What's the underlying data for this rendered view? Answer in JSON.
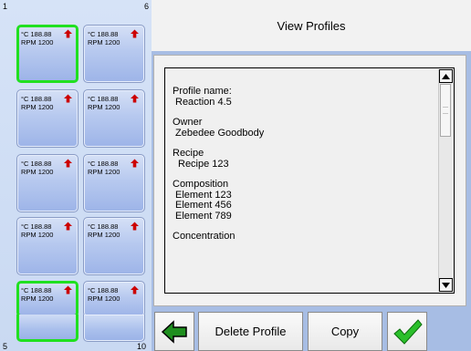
{
  "title": "View Profiles",
  "grid": {
    "corner_labels": {
      "top_left": "1",
      "top_right": "6",
      "bottom_left": "5",
      "bottom_right": "10"
    },
    "cells": [
      {
        "temp": "°C 188.88",
        "rpm": "RPM 1200",
        "selected": true,
        "has_data": true
      },
      {
        "temp": "°C 188.88",
        "rpm": "RPM 1200",
        "selected": false,
        "has_data": true
      },
      {
        "temp": "°C 188.88",
        "rpm": "RPM 1200",
        "selected": false,
        "has_data": true
      },
      {
        "temp": "°C 188.88",
        "rpm": "RPM 1200",
        "selected": false,
        "has_data": true
      },
      {
        "temp": "°C 188.88",
        "rpm": "RPM 1200",
        "selected": false,
        "has_data": true
      },
      {
        "temp": "°C 188.88",
        "rpm": "RPM 1200",
        "selected": false,
        "has_data": true
      },
      {
        "temp": "°C 188.88",
        "rpm": "RPM 1200",
        "selected": false,
        "has_data": true
      },
      {
        "temp": "°C 188.88",
        "rpm": "RPM 1200",
        "selected": false,
        "has_data": true
      },
      {
        "temp": "°C 188.88",
        "rpm": "RPM 1200",
        "selected": true,
        "has_data": true
      },
      {
        "temp": "°C 188.88",
        "rpm": "RPM 1200",
        "selected": false,
        "has_data": true
      },
      {
        "temp": "",
        "rpm": "",
        "selected": true,
        "has_data": false
      },
      {
        "temp": "",
        "rpm": "",
        "selected": false,
        "has_data": false
      }
    ]
  },
  "profile": {
    "name_label": "Profile name:",
    "name_value": "Reaction 4.5",
    "owner_label": "Owner",
    "owner_value": "Zebedee Goodbody",
    "recipe_label": "Recipe",
    "recipe_value": "Recipe 123",
    "composition_label": "Composition",
    "composition_items": [
      "Element 123",
      "Element 456",
      "Element 789"
    ],
    "concentration_label": "Concentration"
  },
  "buttons": {
    "delete_label": "Delete Profile",
    "copy_label": "Copy"
  },
  "icons": {
    "back": "left-arrow-icon",
    "ok": "checkmark-icon",
    "cell_indicator": "up-arrow-icon"
  },
  "colors": {
    "selected_border": "#20e020",
    "arrow_red": "#cc0000",
    "check_green": "#2bbf2b",
    "back_arrow_green": "#1f8f1f"
  }
}
